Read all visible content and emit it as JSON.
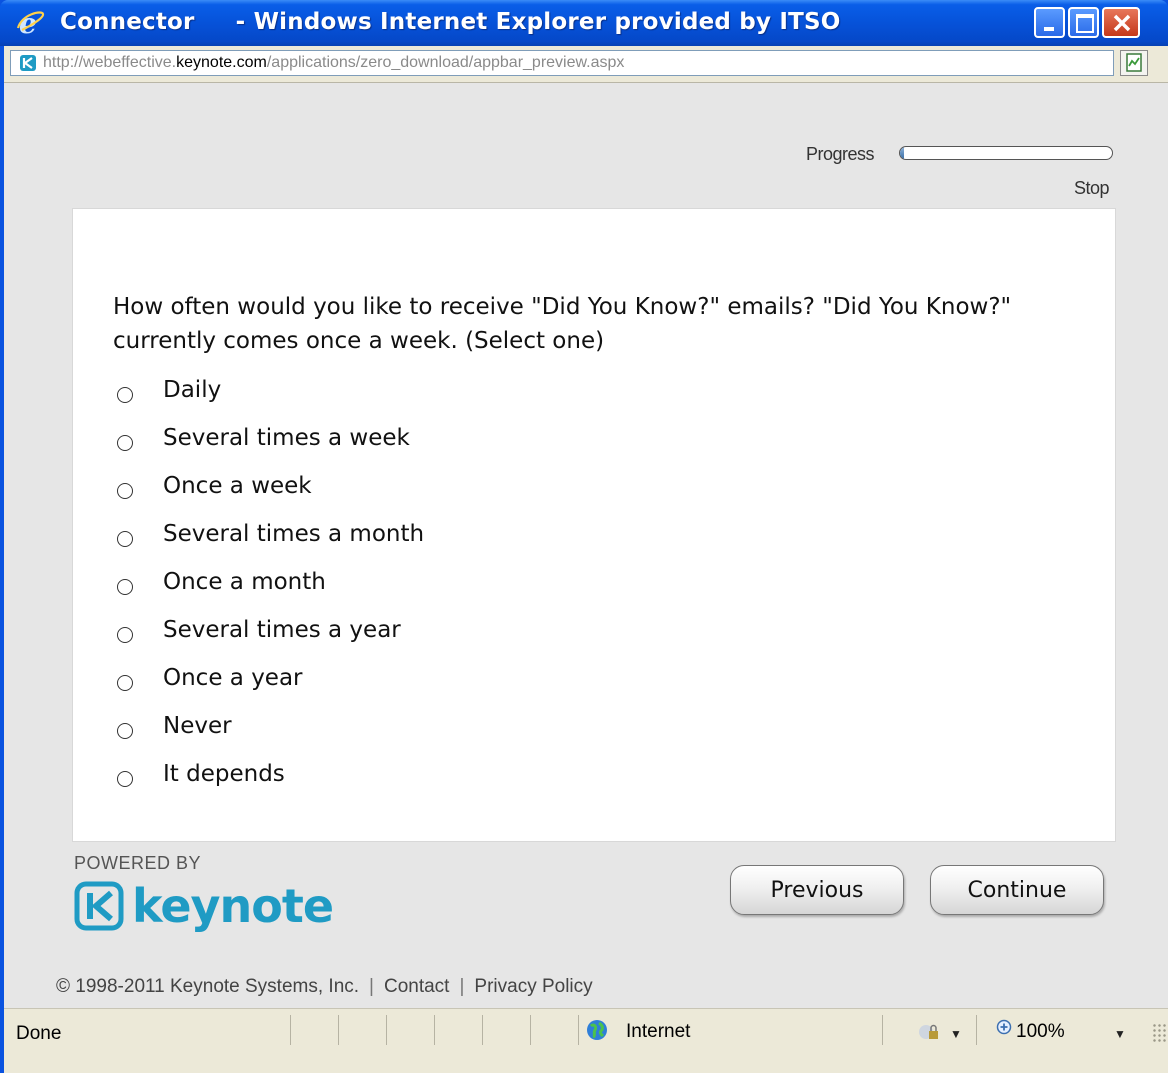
{
  "window": {
    "title_app": "Connector",
    "title_rest": "     - Windows Internet Explorer provided by ITSO"
  },
  "address": {
    "prefix": "http://webeffective.",
    "domain": "keynote.com",
    "path": "/applications/zero_download/appbar_preview.aspx"
  },
  "toolbar": {
    "progress_label": "Progress",
    "progress_value": 0.02,
    "stop_label": "Stop"
  },
  "survey": {
    "question": "How often would you like to receive \"Did You Know?\" emails? \"Did You Know?\" currently comes once a week. (Select one)",
    "options": [
      "Daily",
      "Several times a week",
      "Once a week",
      "Several times a month",
      "Once a month",
      "Several times a year",
      "Once a year",
      "Never",
      "It depends"
    ]
  },
  "branding": {
    "powered_by": "POWERED BY",
    "logo_word": "keynote",
    "brand_color": "#1f9bc4"
  },
  "nav": {
    "previous_label": "Previous",
    "continue_label": "Continue"
  },
  "footer": {
    "copyright": "© 1998-2011 Keynote Systems, Inc.",
    "contact": "Contact",
    "privacy": "Privacy Policy",
    "separator": "|"
  },
  "status": {
    "text": "Done",
    "zone": "Internet",
    "zoom": "100%"
  },
  "icons": {
    "title": "ie-logo-icon",
    "site": "keynote-favicon-icon",
    "go": "compatibility-view-icon",
    "zone": "globe-icon",
    "lock": "protected-mode-icon",
    "zoom": "zoom-icon"
  }
}
